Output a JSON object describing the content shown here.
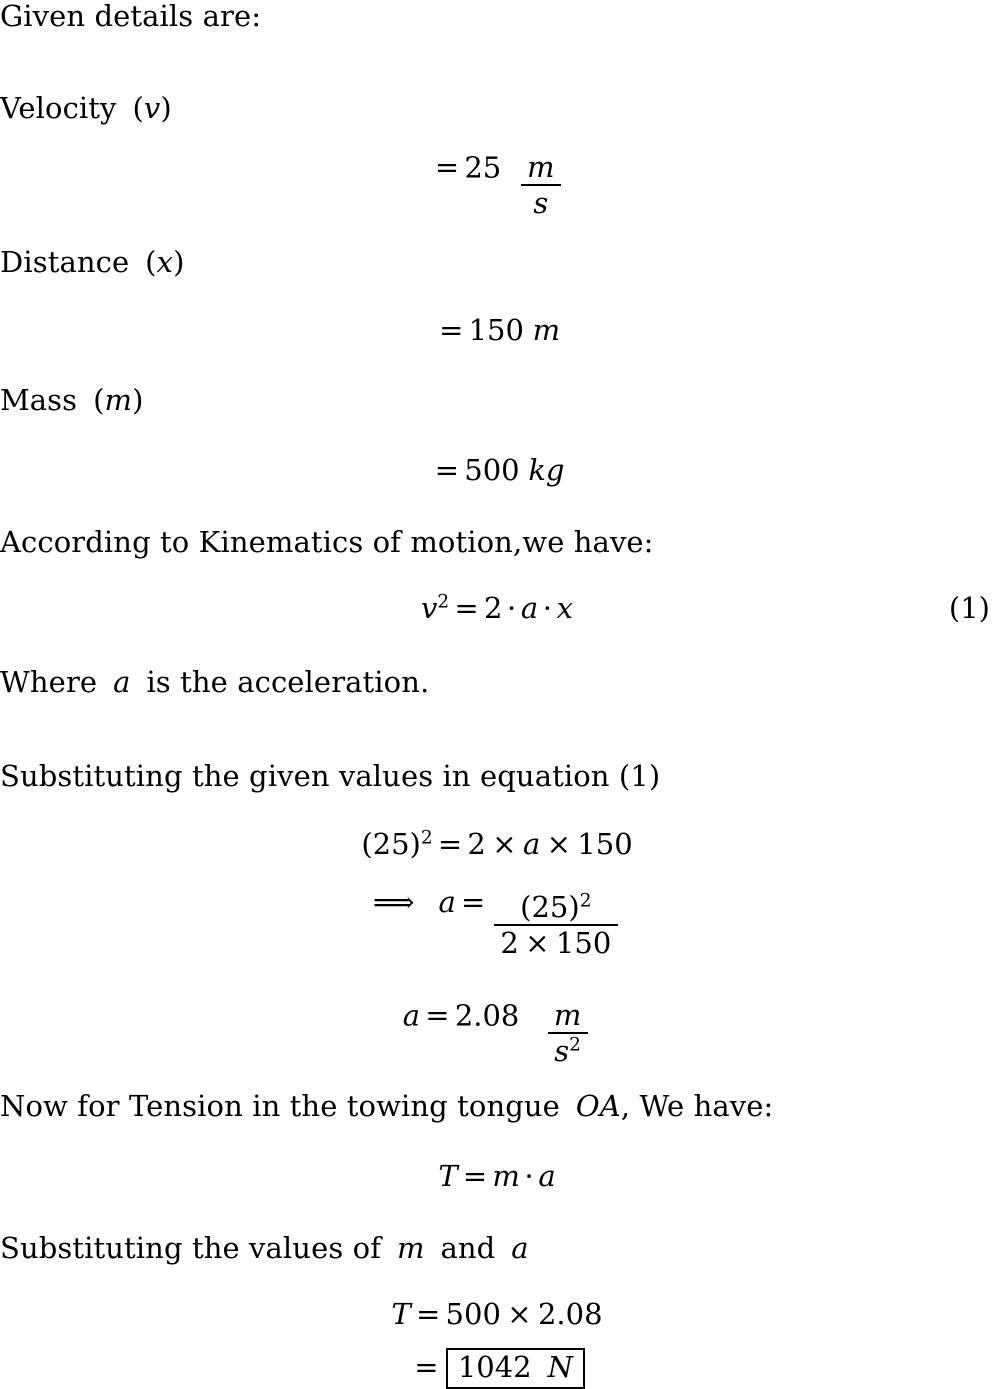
{
  "document": {
    "type": "latex-math-solution",
    "title_line": "Given details are:",
    "background_color": "#ffffff",
    "text_color": "#000000"
  },
  "lines": {
    "given_heading": "Given details are:",
    "velocity_label_text": "Velocity",
    "velocity_label_var": "v",
    "distance_label_text": "Distance",
    "distance_label_var": "x",
    "mass_label_text": "Mass",
    "mass_label_var": "m",
    "kinematics_intro": "According to Kinematics of motion,we have:",
    "where_prefix": "Where",
    "where_var": "a",
    "where_suffix": "is the acceleration.",
    "substituting_intro": "Substituting the given values in equation (1)",
    "tension_intro_prefix": "Now for Tension in the towing tongue",
    "tension_intro_var": "OA",
    "tension_intro_suffix": ", We have:",
    "substituting_values_prefix": "Substituting the values of",
    "substituting_values_var1": "m",
    "substituting_values_mid": "and",
    "substituting_values_var2": "a"
  },
  "equations": {
    "velocity": {
      "equals": "=",
      "value": "25",
      "unit_numerator": "m",
      "unit_denominator": "s"
    },
    "distance": {
      "equals": "=",
      "value": "150",
      "unit": "m"
    },
    "mass": {
      "equals": "=",
      "value": "500",
      "unit": "kg"
    },
    "kinematics": {
      "lhs_var": "v",
      "lhs_exponent": "2",
      "equals": "=",
      "coefficient": "2",
      "dot": "·",
      "var_a": "a",
      "var_x": "x",
      "tag": "(1)"
    },
    "substitution_1": {
      "lhs": "(25)",
      "lhs_exponent": "2",
      "equals": "=",
      "factor1": "2",
      "times": "×",
      "var_a": "a",
      "factor2": "150"
    },
    "substitution_2": {
      "arrow": "⟹",
      "var_a": "a",
      "equals": "=",
      "numerator": "(25)",
      "numerator_exponent": "2",
      "denominator_factor1": "2",
      "times": "×",
      "denominator_factor2": "150"
    },
    "acceleration_result": {
      "var_a": "a",
      "equals": "=",
      "value": "2.08",
      "unit_numerator": "m",
      "unit_denominator": "s",
      "unit_denominator_exponent": "2"
    },
    "tension_formula": {
      "var_T": "T",
      "equals": "=",
      "var_m": "m",
      "dot": "·",
      "var_a": "a"
    },
    "tension_substitution": {
      "var_T": "T",
      "equals": "=",
      "factor1": "500",
      "times": "×",
      "factor2": "2.08"
    },
    "tension_result": {
      "equals": "=",
      "boxed_value": "1042",
      "boxed_unit": "N"
    }
  }
}
